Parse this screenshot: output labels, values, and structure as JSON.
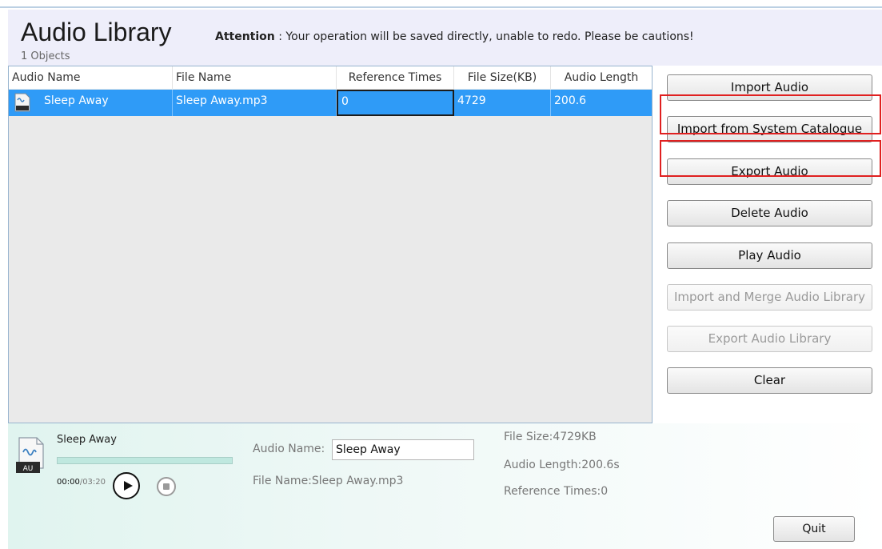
{
  "header": {
    "title": "Audio Library",
    "attention_label": "Attention",
    "attention_text": " : Your operation will be saved directly, unable to redo. Please be cautions!",
    "object_count": "1 Objects"
  },
  "table": {
    "columns": [
      "Audio Name",
      "File Name",
      "Reference Times",
      "File Size(KB)",
      "Audio Length"
    ],
    "rows": [
      {
        "audio_name": "Sleep Away",
        "file_name": "Sleep Away.mp3",
        "reference_times": "0",
        "file_size": "4729",
        "audio_length": "200.6",
        "icon": "audio-file-icon",
        "selected": true
      }
    ]
  },
  "sidebar": {
    "buttons": [
      {
        "label": "Import Audio",
        "enabled": true
      },
      {
        "label": "Import from System Catalogue",
        "enabled": true,
        "highlighted": true
      },
      {
        "label": "Export Audio",
        "enabled": true,
        "highlighted": true
      },
      {
        "label": "Delete Audio",
        "enabled": true
      },
      {
        "label": "Play Audio",
        "enabled": true
      },
      {
        "label": "Import and Merge Audio Library",
        "enabled": false
      },
      {
        "label": "Export Audio Library",
        "enabled": false
      },
      {
        "label": "Clear",
        "enabled": true
      }
    ]
  },
  "player": {
    "title": "Sleep Away",
    "file_badge": "AU",
    "current_time": "00:00",
    "total_time": "/03:20",
    "progress": 0
  },
  "details": {
    "audio_name_label": "Audio Name:",
    "audio_name_value": "Sleep Away",
    "file_name": "File Name:Sleep Away.mp3",
    "file_size": "File Size:4729KB",
    "audio_length": "Audio Length:200.6s",
    "reference_times": "Reference Times:0"
  },
  "quit_label": "Quit",
  "colors": {
    "selection": "#2f9bf7",
    "header_bg": "#eeeefa",
    "highlight_box": "#e02020"
  }
}
